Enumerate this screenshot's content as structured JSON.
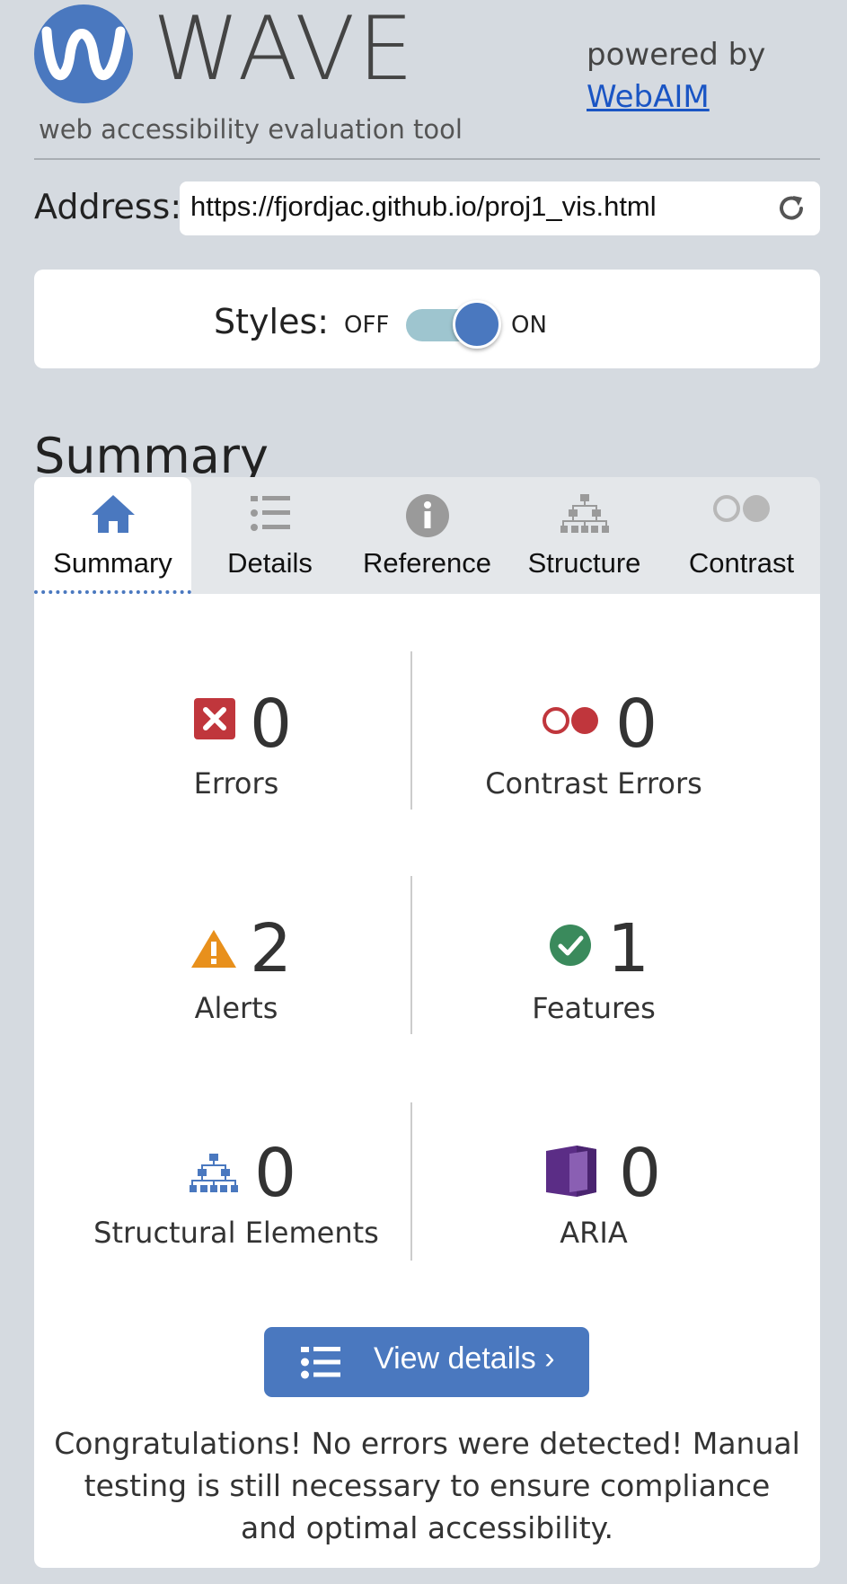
{
  "header": {
    "logo_text": "WAVE",
    "tagline": "web accessibility evaluation tool",
    "powered_by": "powered by",
    "powered_link": "WebAIM"
  },
  "address": {
    "label": "Address:",
    "value": "https://fjordjac.github.io/proj1_vis.html",
    "reload_icon": "reload-icon"
  },
  "styles": {
    "label": "Styles:",
    "off": "OFF",
    "on": "ON",
    "state": "on"
  },
  "summary_heading": "Summary",
  "tabs": [
    {
      "label": "Summary",
      "icon": "home-icon",
      "active": true
    },
    {
      "label": "Details",
      "icon": "details-list-icon",
      "active": false
    },
    {
      "label": "Reference",
      "icon": "info-icon",
      "active": false
    },
    {
      "label": "Structure",
      "icon": "structure-icon",
      "active": false
    },
    {
      "label": "Contrast",
      "icon": "contrast-icon",
      "active": false
    }
  ],
  "stats": {
    "errors": {
      "count": "0",
      "label": "Errors",
      "icon": "error-icon",
      "color": "#c0363c"
    },
    "contrast_errors": {
      "count": "0",
      "label": "Contrast Errors",
      "icon": "contrast-error-icon",
      "color": "#c0363c"
    },
    "alerts": {
      "count": "2",
      "label": "Alerts",
      "icon": "alert-icon",
      "color": "#e8901c"
    },
    "features": {
      "count": "1",
      "label": "Features",
      "icon": "feature-check-icon",
      "color": "#3a8a5c"
    },
    "structural": {
      "count": "0",
      "label": "Structural Elements",
      "icon": "structure-icon",
      "color": "#4a78bf"
    },
    "aria": {
      "count": "0",
      "label": "ARIA",
      "icon": "aria-icon",
      "color": "#5b2d86"
    }
  },
  "view_details": "View details ›",
  "congrats": "Congratulations! No errors were detected! Manual testing is still necessary to ensure compliance and optimal accessibility.",
  "colors": {
    "accent": "#4a78bf",
    "background": "#d5dae0",
    "error": "#c0363c",
    "alert": "#e8901c",
    "feature": "#3a8a5c",
    "aria": "#5b2d86"
  }
}
